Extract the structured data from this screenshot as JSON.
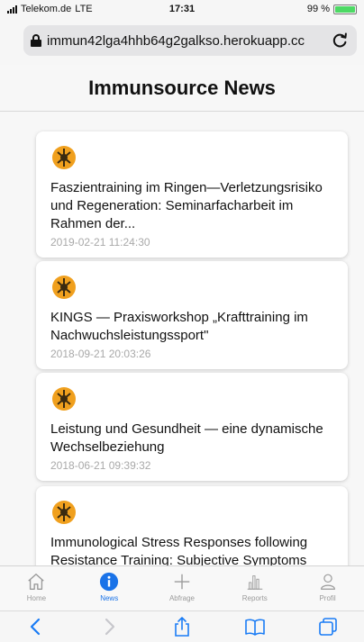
{
  "status_bar": {
    "carrier": "Telekom.de",
    "network": "LTE",
    "time": "17:31",
    "battery": "99 %",
    "battery_level": 0.99
  },
  "url_bar": {
    "url": "immun42lga4hhb64g2galkso.herokuapp.cc"
  },
  "header": {
    "title": "Immunsource News"
  },
  "news": [
    {
      "title": "Faszientraining im Ringen—Verletzungsrisiko und Regeneration: Seminarfacharbeit im Rahmen der...",
      "date": "2019-02-21 11:24:30"
    },
    {
      "title": "KINGS — Praxisworkshop „Krafttraining im Nachwuchsleistungssport\"",
      "date": "2018-09-21 20:03:26"
    },
    {
      "title": "Leistung und Gesundheit — eine dynamische Wechselbeziehung",
      "date": "2018-06-21 09:39:32"
    },
    {
      "title": "Immunological Stress Responses following Resistance Training: Subjective Symptoms",
      "date": ""
    }
  ],
  "tabs": [
    {
      "label": "Home",
      "icon": "home-icon"
    },
    {
      "label": "News",
      "icon": "info-icon",
      "active": true
    },
    {
      "label": "Abfrage",
      "icon": "plus-icon"
    },
    {
      "label": "Reports",
      "icon": "bar-chart-icon"
    },
    {
      "label": "Profil",
      "icon": "person-icon"
    }
  ],
  "colors": {
    "accent": "#1a73e8",
    "logo_orange": "#f0a01e",
    "date_gray": "#a9a9a9",
    "safari_blue": "#1a7cf5"
  }
}
